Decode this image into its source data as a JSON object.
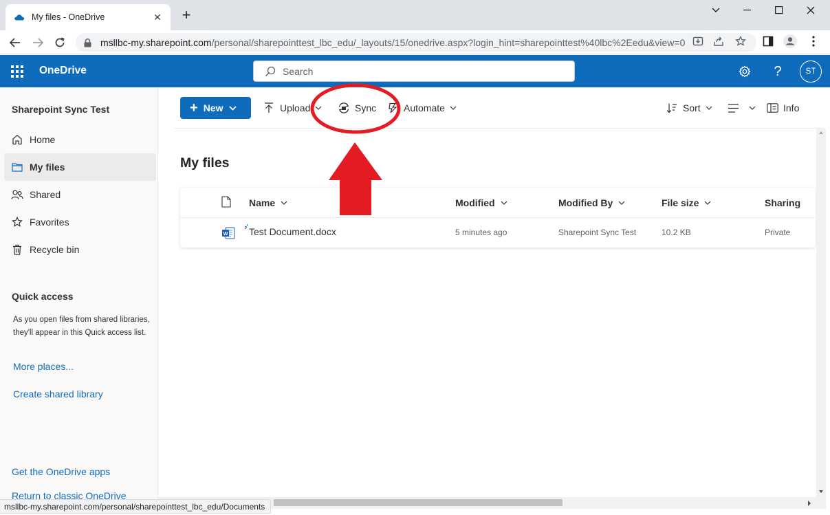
{
  "browser": {
    "tab_title": "My files - OneDrive",
    "url_host": "msllbc-my.sharepoint.com",
    "url_path": "/personal/sharepointtest_lbc_edu/_layouts/15/onedrive.aspx?login_hint=sharepointtest%40lbc%2Eedu&view=0",
    "status_url": "msllbc-my.sharepoint.com/personal/sharepointtest_lbc_edu/Documents"
  },
  "suite": {
    "app_name": "OneDrive",
    "search_placeholder": "Search",
    "avatar_initials": "ST"
  },
  "sidebar": {
    "site_name": "Sharepoint Sync Test",
    "items": [
      {
        "label": "Home",
        "icon": "home-icon"
      },
      {
        "label": "My files",
        "icon": "folder-icon",
        "active": true
      },
      {
        "label": "Shared",
        "icon": "people-icon"
      },
      {
        "label": "Favorites",
        "icon": "star-icon"
      },
      {
        "label": "Recycle bin",
        "icon": "trash-icon"
      }
    ],
    "quick_access_heading": "Quick access",
    "quick_access_desc": "As you open files from shared libraries, they'll appear in this Quick access list.",
    "more_places": "More places...",
    "create_library": "Create shared library",
    "get_apps": "Get the OneDrive apps",
    "classic": "Return to classic OneDrive"
  },
  "commandbar": {
    "new_label": "New",
    "upload_label": "Upload",
    "sync_label": "Sync",
    "automate_label": "Automate",
    "sort_label": "Sort",
    "info_label": "Info"
  },
  "main": {
    "title": "My files",
    "columns": [
      "Name",
      "Modified",
      "Modified By",
      "File size",
      "Sharing"
    ],
    "rows": [
      {
        "name": "Test Document.docx",
        "modified": "5 minutes ago",
        "modified_by": "Sharepoint Sync Test",
        "size": "10.2 KB",
        "sharing": "Private"
      }
    ]
  },
  "colors": {
    "brand_blue": "#0f6cbd",
    "annotation_red": "#e31b23"
  }
}
